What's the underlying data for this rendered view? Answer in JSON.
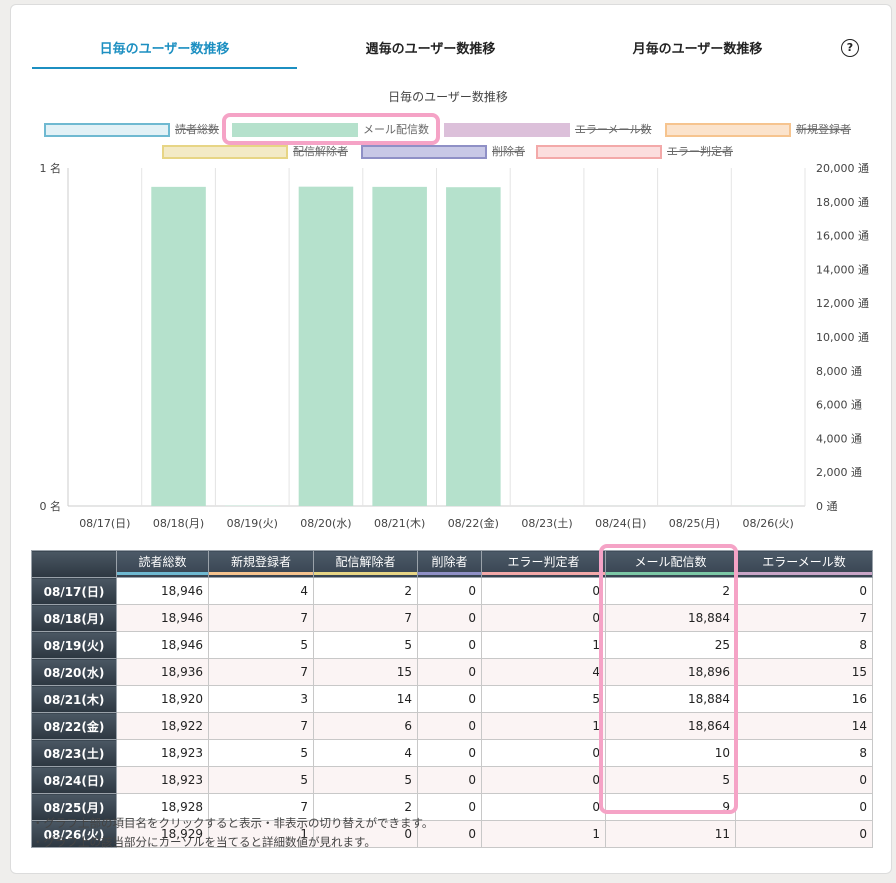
{
  "tabs": [
    {
      "label": "日毎のユーザー数推移"
    },
    {
      "label": "週毎のユーザー数推移"
    },
    {
      "label": "月毎のユーザー数推移"
    }
  ],
  "help_label": "?",
  "chart": {
    "title": "日毎のユーザー数推移"
  },
  "legend": [
    {
      "name": "読者総数",
      "color": "#6fb9d1",
      "fill": "#e2f1f6",
      "active": false
    },
    {
      "name": "メール配信数",
      "color": "#b5e1cc",
      "fill": "#b5e1cc",
      "active": true
    },
    {
      "name": "エラーメール数",
      "color": "#dcc0da",
      "fill": "#dcc0da",
      "active": false
    },
    {
      "name": "新規登録者",
      "color": "#f6c48f",
      "fill": "#fbe3cc",
      "active": false
    },
    {
      "name": "配信解除者",
      "color": "#e7d585",
      "fill": "#f3eac6",
      "active": false
    },
    {
      "name": "削除者",
      "color": "#8f90c6",
      "fill": "#c8c8e6",
      "active": false
    },
    {
      "name": "エラー判定者",
      "color": "#f3a9a9",
      "fill": "#fbdede",
      "active": false
    }
  ],
  "chart_data": {
    "type": "bar",
    "categories": [
      "08/17(日)",
      "08/18(月)",
      "08/19(火)",
      "08/20(水)",
      "08/21(木)",
      "08/22(金)",
      "08/23(土)",
      "08/24(日)",
      "08/25(月)",
      "08/26(火)"
    ],
    "series": [
      {
        "name": "メール配信数",
        "axis": "right",
        "color": "#b5e1cc",
        "values": [
          2,
          18884,
          25,
          18896,
          18884,
          18864,
          10,
          5,
          9,
          11
        ]
      }
    ],
    "y_left": {
      "min": 0,
      "max": 1,
      "ticks": [
        "0 名",
        "1 名"
      ]
    },
    "y_right": {
      "min": 0,
      "max": 20000,
      "step": 2000,
      "unit": "通"
    }
  },
  "table": {
    "headers": [
      "読者総数",
      "新規登録者",
      "配信解除者",
      "削除者",
      "エラー判定者",
      "メール配信数",
      "エラーメール数"
    ],
    "header_colors": [
      "#6fb9d1",
      "#f6c48f",
      "#e7d585",
      "#8f90c6",
      "#f3a9a9",
      "#7cc8a6",
      "#c9a5c7"
    ],
    "rows": [
      {
        "date": "08/17(日)",
        "values": [
          "18,946",
          "4",
          "2",
          "0",
          "0",
          "2",
          "0"
        ]
      },
      {
        "date": "08/18(月)",
        "values": [
          "18,946",
          "7",
          "7",
          "0",
          "0",
          "18,884",
          "7"
        ]
      },
      {
        "date": "08/19(火)",
        "values": [
          "18,946",
          "5",
          "5",
          "0",
          "1",
          "25",
          "8"
        ]
      },
      {
        "date": "08/20(水)",
        "values": [
          "18,936",
          "7",
          "15",
          "0",
          "4",
          "18,896",
          "15"
        ]
      },
      {
        "date": "08/21(木)",
        "values": [
          "18,920",
          "3",
          "14",
          "0",
          "5",
          "18,884",
          "16"
        ]
      },
      {
        "date": "08/22(金)",
        "values": [
          "18,922",
          "7",
          "6",
          "0",
          "1",
          "18,864",
          "14"
        ]
      },
      {
        "date": "08/23(土)",
        "values": [
          "18,923",
          "5",
          "4",
          "0",
          "0",
          "10",
          "8"
        ]
      },
      {
        "date": "08/24(日)",
        "values": [
          "18,923",
          "5",
          "5",
          "0",
          "0",
          "5",
          "0"
        ]
      },
      {
        "date": "08/25(月)",
        "values": [
          "18,928",
          "7",
          "2",
          "0",
          "0",
          "9",
          "0"
        ]
      },
      {
        "date": "08/26(火)",
        "values": [
          "18,929",
          "1",
          "0",
          "0",
          "1",
          "11",
          "0"
        ]
      }
    ]
  },
  "notes": [
    "・グラフ上部の項目名をクリックすると表示・非表示の切り替えができます。",
    "・グラフ上の該当部分にカーソルを当てると詳細数値が見れます。"
  ]
}
